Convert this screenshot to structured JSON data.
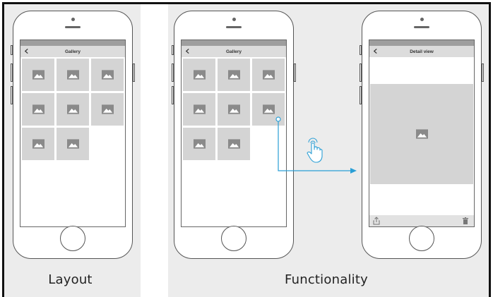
{
  "captions": {
    "layout": "Layout",
    "functionality": "Functionality"
  },
  "screens": {
    "gallery_title": "Gallery",
    "detail_title": "Detail view"
  },
  "gallery": {
    "thumbnail_count": 8,
    "columns": 3
  },
  "icons": {
    "back": "chevron-left-icon",
    "image": "image-placeholder-icon",
    "tap": "tap-hand-icon",
    "share": "share-icon",
    "delete": "trash-icon"
  },
  "colors": {
    "accent": "#2a9fd6",
    "placeholder": "#d4d4d4",
    "panel": "#ececec"
  }
}
